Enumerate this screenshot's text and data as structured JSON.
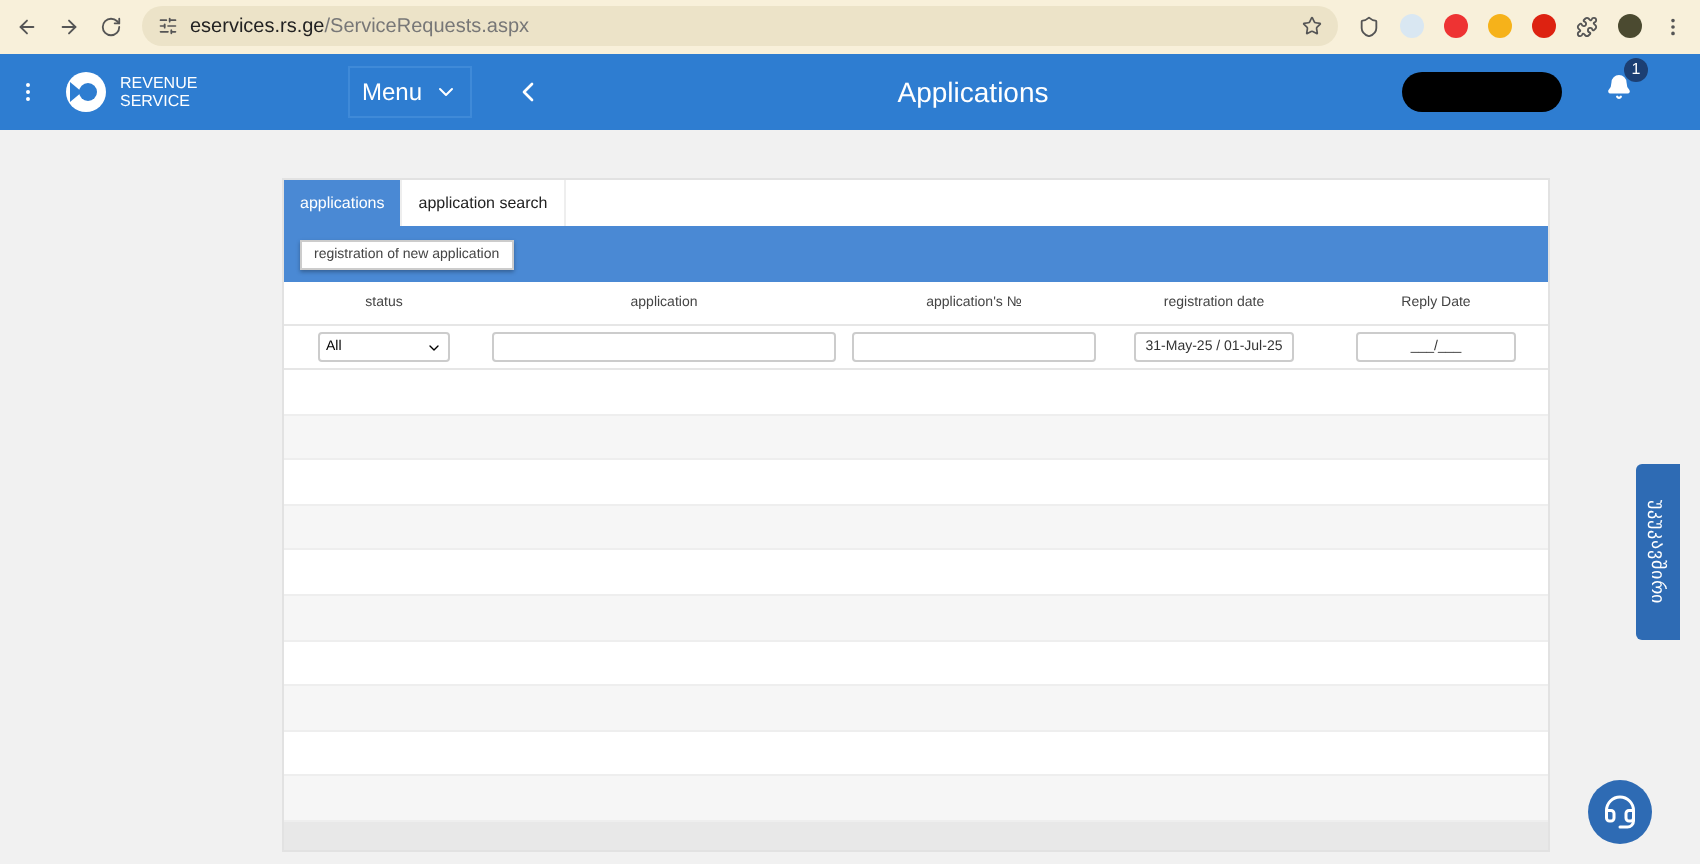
{
  "browser": {
    "url_host": "eservices.rs.ge",
    "url_path": "/ServiceRequests.aspx"
  },
  "header": {
    "logo_text": [
      "REVENUE",
      "SERVICE"
    ],
    "menu_label": "Menu",
    "title": "Applications",
    "notification_count": "1"
  },
  "tabs": [
    {
      "label": "applications",
      "selected": true
    },
    {
      "label": "application search",
      "selected": false
    }
  ],
  "action_button": "registration of new application",
  "table": {
    "columns": [
      "status",
      "application",
      "application's №",
      "registration date",
      "Reply Date"
    ],
    "filters": [
      {
        "kind": "select",
        "value": "All"
      },
      {
        "kind": "text"
      },
      {
        "kind": "text"
      },
      {
        "kind": "date",
        "value": "31-May-25 / 01-Jul-25"
      },
      {
        "kind": "date",
        "value": "___/___"
      }
    ]
  },
  "side_tab": "უკუკავშირი"
}
